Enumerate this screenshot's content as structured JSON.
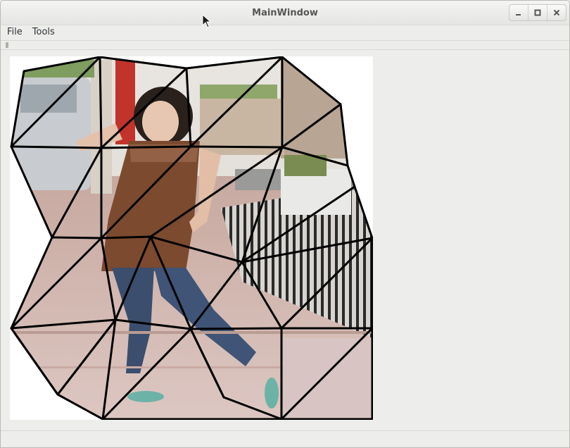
{
  "window": {
    "title": "MainWindow"
  },
  "menubar": {
    "items": [
      {
        "label": "File"
      },
      {
        "label": "Tools"
      }
    ]
  },
  "window_controls": {
    "minimize_icon": "minimize-icon",
    "maximize_icon": "maximize-icon",
    "close_icon": "close-icon"
  },
  "canvas": {
    "background": "#ffffff",
    "mesh_color": "#000000",
    "content": "warped photo of a woman standing on a sidewalk, overlaid with a black triangle mesh"
  },
  "colors": {
    "window_bg": "#ededeb",
    "title_text": "#555753",
    "menu_text": "#2e3436"
  }
}
